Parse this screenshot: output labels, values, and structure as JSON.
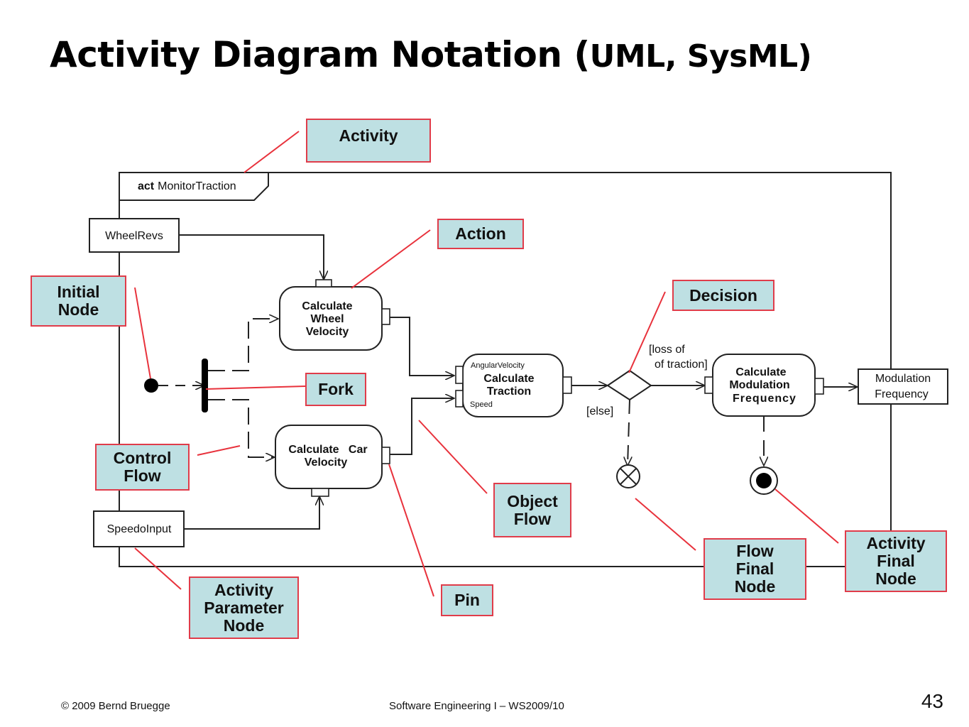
{
  "slide": {
    "title_main": "Activity Diagram Notation (",
    "title_small": "UML, SysML)",
    "footer_left": "© 2009 Bernd Bruegge",
    "footer_center": "Software Engineering I – WS2009/10",
    "page_number": "43"
  },
  "diagram": {
    "frame_keyword": "act",
    "frame_name": "MonitorTraction",
    "parameter_nodes": {
      "wheel_revs": "WheelRevs",
      "speedo_input": "SpeedoInput",
      "modulation_frequency_line1": "Modulation",
      "modulation_frequency_line2": "Frequency"
    },
    "actions": {
      "calc_wheel_velocity": [
        "Calculate",
        "Wheel",
        "Velocity"
      ],
      "calc_car_velocity": [
        "Calculate   Car",
        "Velocity"
      ],
      "calc_traction": [
        "Calculate",
        "Traction"
      ],
      "calc_modulation_frequency": [
        "Calculate",
        "Modulation",
        "Frequency"
      ]
    },
    "pins": {
      "angular_velocity": "AngularVelocity",
      "speed": "Speed"
    },
    "guards": {
      "loss_line1": "[loss of",
      "loss_line2": "of traction]",
      "else": "[else]"
    }
  },
  "callouts": {
    "activity": "Activity",
    "action": "Action",
    "initial_node": "Initial\nNode",
    "fork": "Fork",
    "decision": "Decision",
    "control_flow": "Control\nFlow",
    "object_flow": "Object\nFlow",
    "flow_final_node": "Flow\nFinal\nNode",
    "activity_final_node": "Activity\nFinal\nNode",
    "activity_parameter_node": "Activity\nParameter\nNode",
    "pin": "Pin"
  },
  "colors": {
    "callout_fill": "#bee0e3",
    "callout_border": "#e03c4a",
    "leader_line": "#e8323c",
    "diagram_line": "#222222"
  }
}
